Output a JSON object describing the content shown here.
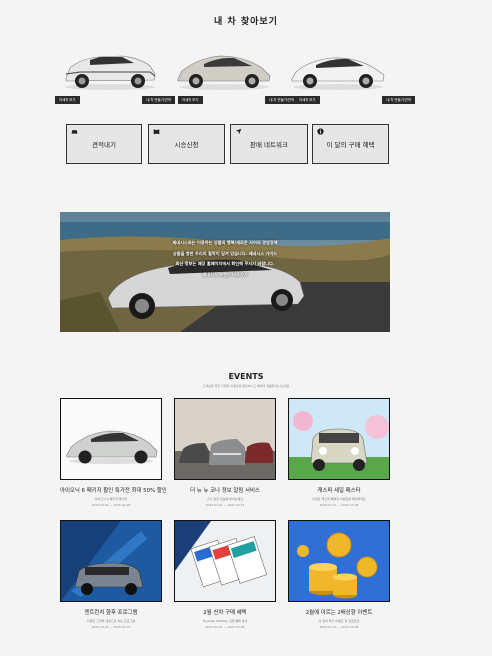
{
  "page": {
    "title": "내 차 찾아보기"
  },
  "cars": [
    {
      "model_label": "자세히 보기",
      "config_label": "내 차 만들기/견적"
    },
    {
      "model_label": "자세히 보기",
      "config_label": "내 차 만들기/견적"
    },
    {
      "model_label": "자세히 보기",
      "config_label": "내 차 만들기/견적"
    }
  ],
  "quick_links": [
    {
      "label": "견적내기",
      "icon": "car-icon"
    },
    {
      "label": "시승신청",
      "icon": "book-icon"
    },
    {
      "label": "판매 네트워크",
      "icon": "location-arrow-icon"
    },
    {
      "label": "이 달의 구매 혜택",
      "icon": "info-icon"
    }
  ],
  "banner": {
    "line1": "제네시스와는 이용하는 상품의 행복/새로운 사이의 경영정책",
    "line2": "상품을 향한 우리의 철학이 담겨 있습니다. 제네시스 가이드",
    "line3": "최신 정보는 매장 홈페이지에서 확인해 주시기 바랍니다.",
    "line4": "제네시스 브랜드 바로가기"
  },
  "events": {
    "title": "EVENTS",
    "subtitle": "고객님을 위한 다양한 이벤트를 확인하시고 혜택과 경품을 만나보세요",
    "items": [
      {
        "title": "아이오닉 6 패키지 할인 특가전 최대 50% 할인",
        "desc": "아이오닉 6 패키지 특가전",
        "date": "2025.02.01 ~ 2025.02.28"
      },
      {
        "title": "더 뉴 뉴 코나 정보 알림 서비스",
        "desc": "출시 관련 정보를 받아보세요",
        "date": "2025.02.01 ~ 2025.02.15"
      },
      {
        "title": "캐스퍼 세일 페스타",
        "desc": "다양한 캐스퍼 혜택과 이벤트를 확인하세요",
        "date": "2025.02.01 ~ 2025.02.28"
      },
      {
        "title": "엔트런치 향후 프로그램",
        "desc": "다양한 고객을 대상으로 하는 프로그램",
        "date": "2025.02.01 ~ 2025.02.15"
      },
      {
        "title": "2월 신차 구매 혜택",
        "desc": "Hyundai Mobility 구매 혜택 안내",
        "date": "2025.02.01 ~ 2025.02.28"
      },
      {
        "title": "2월에 이르는 2배상향 이벤트",
        "desc": "이 달의 특가 이벤트 및 프로모션",
        "date": "2025.02.01 ~ 2025.02.28"
      }
    ]
  },
  "colors": {
    "dark": "#2b2b2b",
    "accent_blue": "#2f6fd6",
    "gold": "#f1b72a"
  }
}
